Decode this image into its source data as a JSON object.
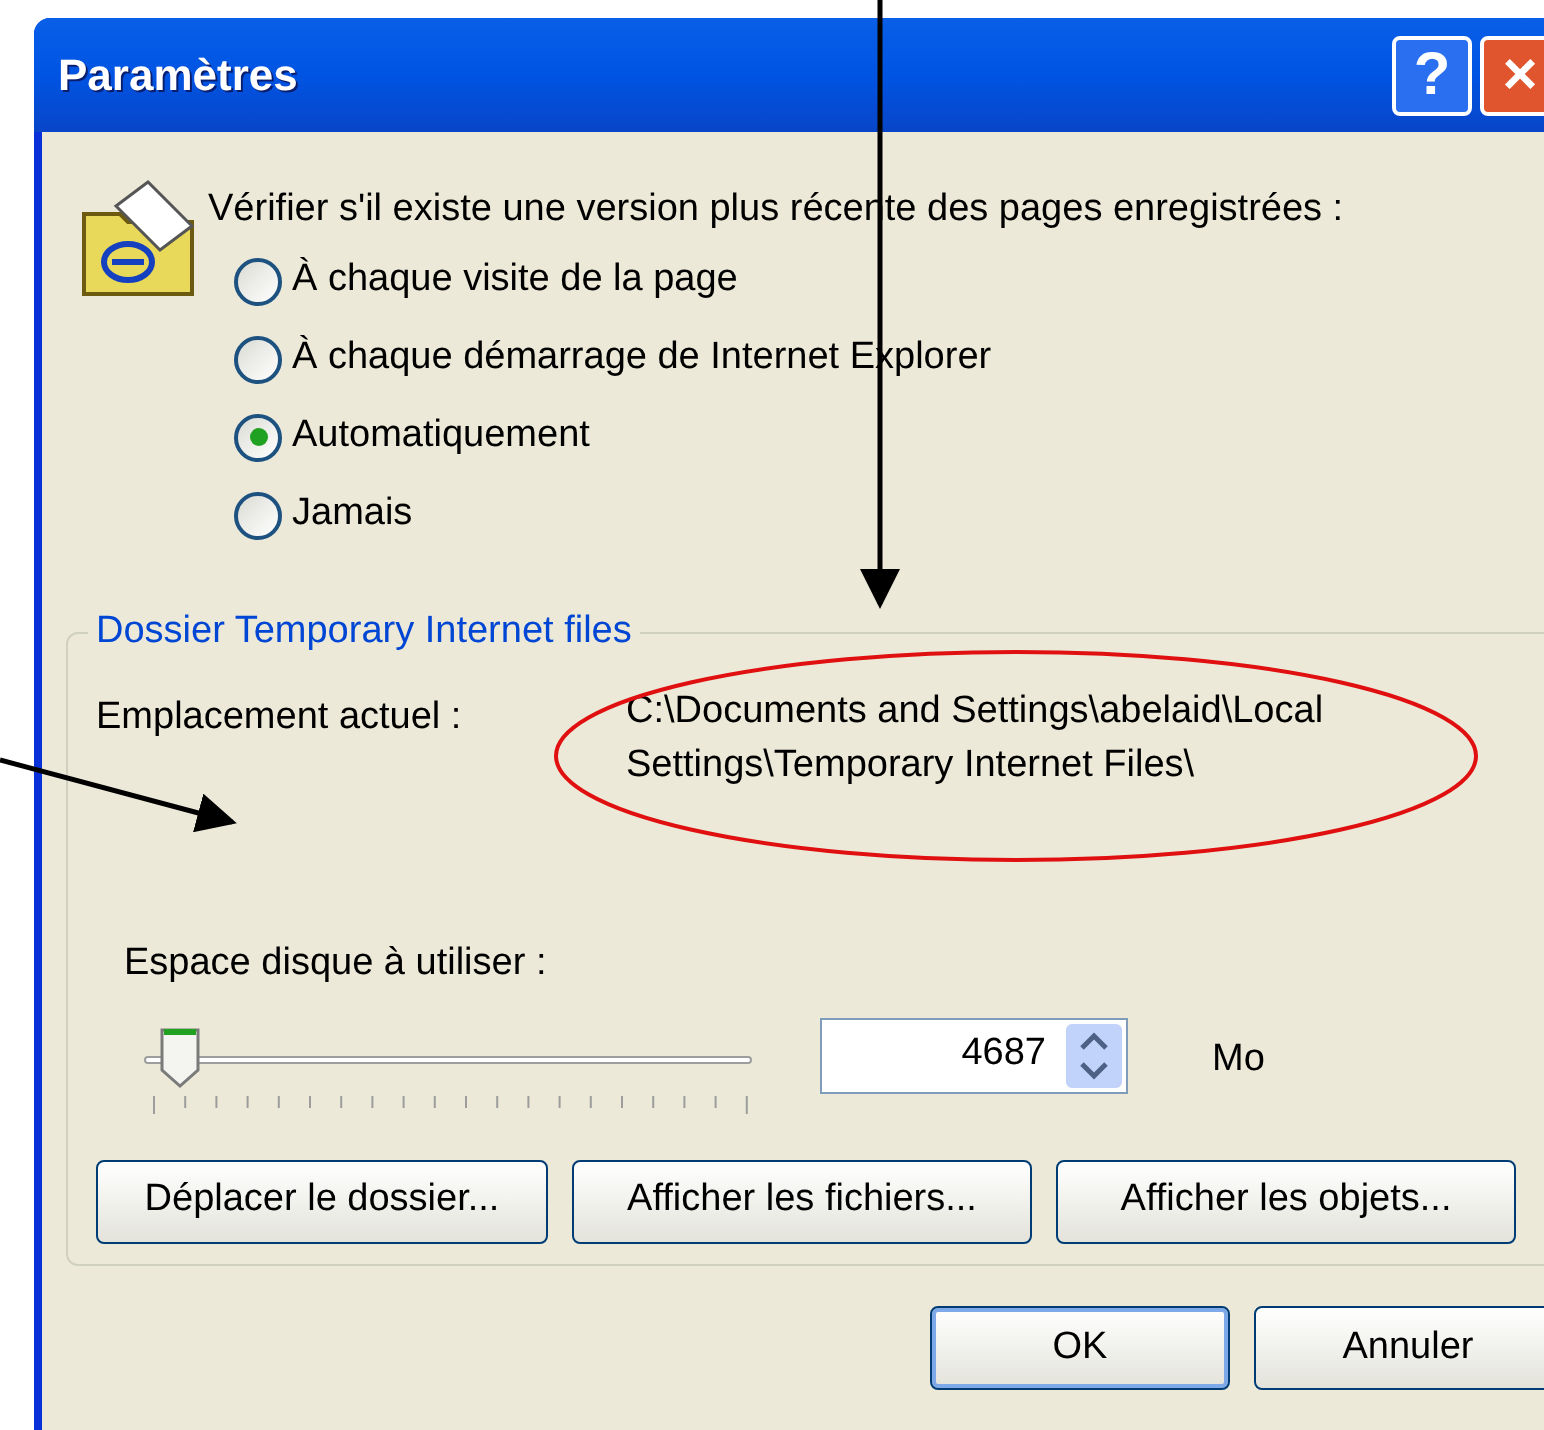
{
  "window": {
    "title": "Paramètres",
    "buttons": [
      "?",
      "×"
    ]
  },
  "check": {
    "prompt": "Vérifier s'il existe une version plus récente des pages enregistrées :",
    "options": [
      {
        "label": "À chaque visite de la page",
        "selected": false
      },
      {
        "label": "À chaque démarrage de Internet Explorer",
        "selected": false
      },
      {
        "label": "Automatiquement",
        "selected": true
      },
      {
        "label": "Jamais",
        "selected": false
      }
    ]
  },
  "group": {
    "title": "Dossier Temporary Internet files",
    "location_label": "Emplacement actuel :",
    "location_lines": [
      "C:\\Documents and Settings\\abelaid\\Local",
      "Settings\\Temporary Internet Files\\"
    ],
    "disk_label": "Espace disque à utiliser :",
    "disk": {
      "level": 0.05,
      "value": "4687",
      "unit": "Mo"
    },
    "buttons": [
      "Déplacer le dossier...",
      "Afficher les fichiers...",
      "Afficher les objets..."
    ]
  },
  "footer_buttons": [
    {
      "label": "OK",
      "default": true
    },
    {
      "label": "Annuler",
      "default": false
    }
  ]
}
